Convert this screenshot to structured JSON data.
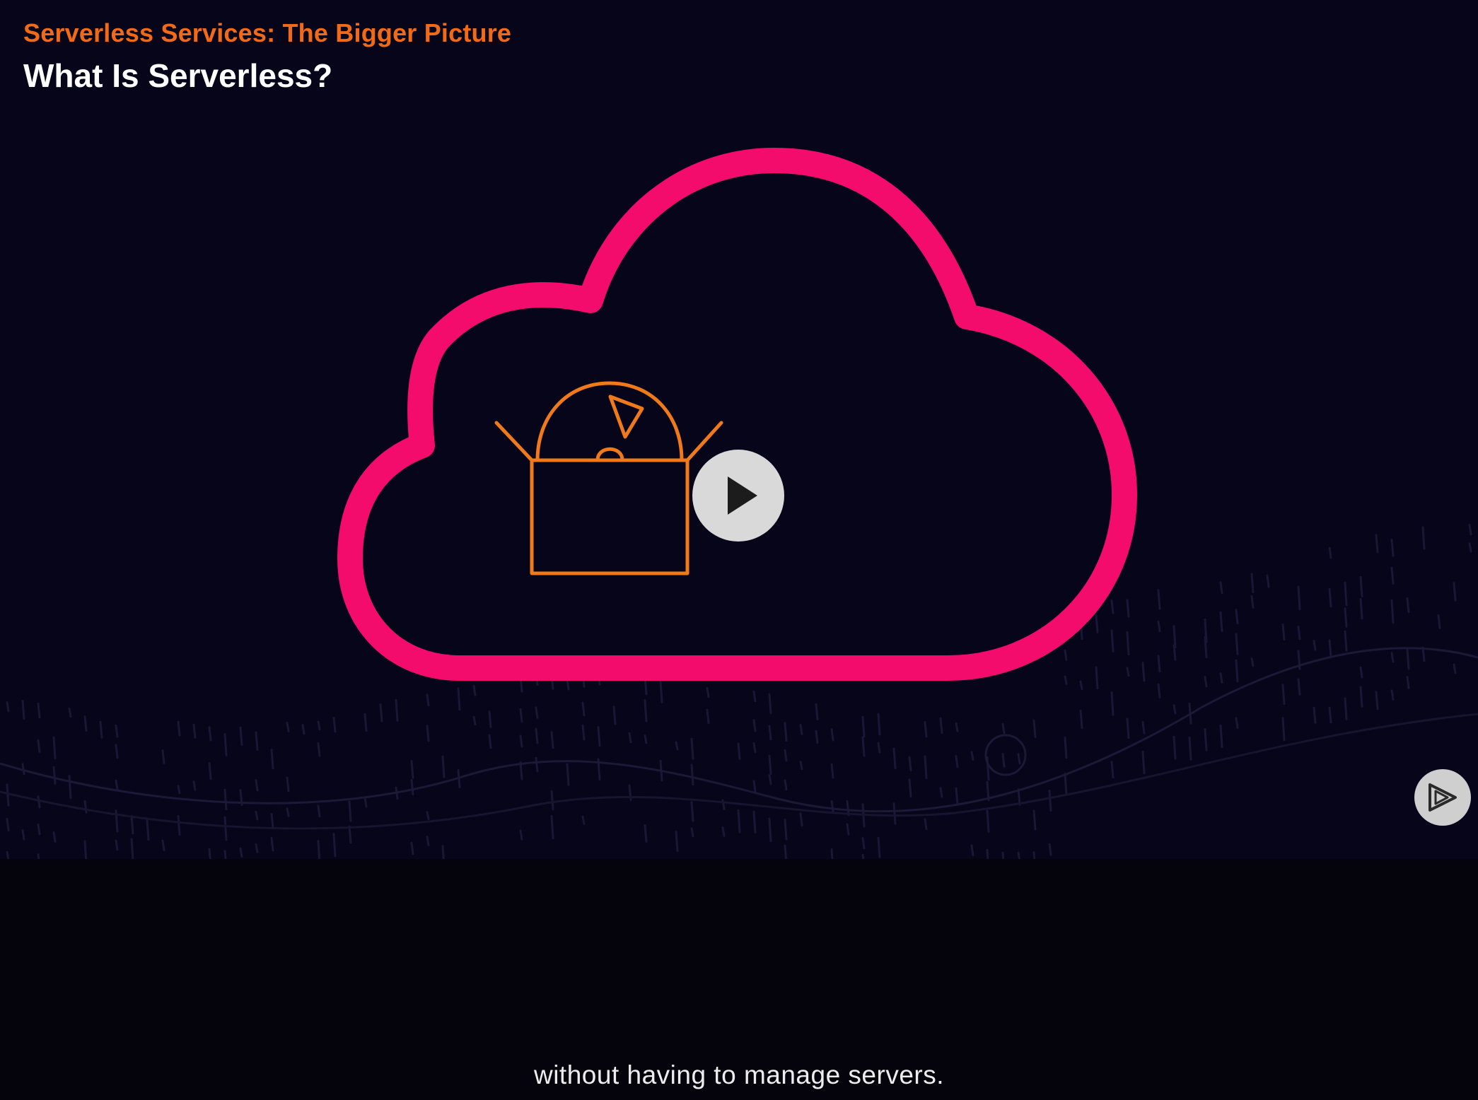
{
  "header": {
    "course_title": "Serverless Services: The Bigger Picture",
    "module_title": "What Is Serverless?"
  },
  "player": {
    "play_button_icon": "play-icon",
    "brand_badge_icon": "pluralsight-play-icon",
    "caption": "without having to manage servers."
  },
  "colors": {
    "course_title": "#f26a16",
    "cloud_outline": "#f30c6b",
    "box_icon": "#f07a1a",
    "background": "#07051a"
  }
}
